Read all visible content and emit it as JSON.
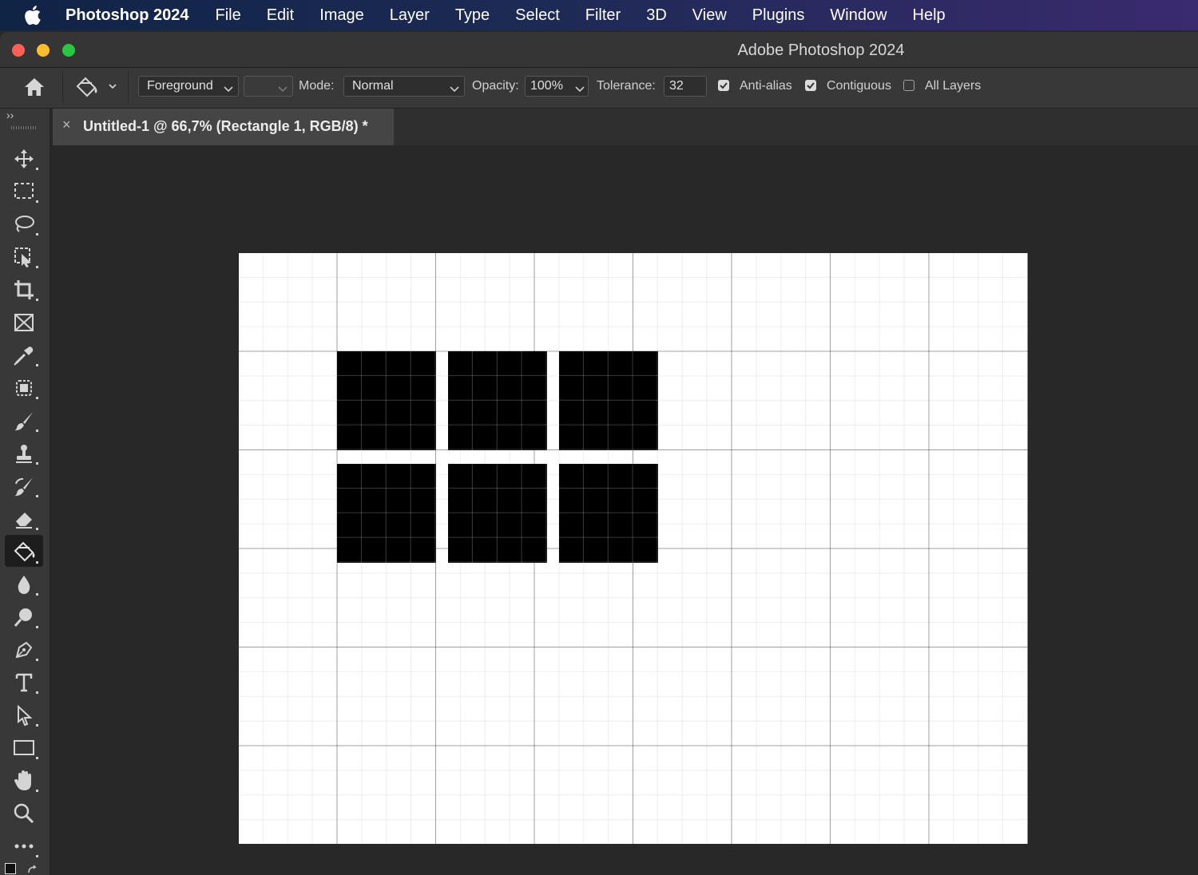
{
  "menubar": {
    "app_name": "Photoshop 2024",
    "items": [
      "File",
      "Edit",
      "Image",
      "Layer",
      "Type",
      "Select",
      "Filter",
      "3D",
      "View",
      "Plugins",
      "Window",
      "Help"
    ]
  },
  "window": {
    "title": "Adobe Photoshop 2024",
    "traffic_lights": {
      "close": "#ff5f57",
      "minimize": "#febc2e",
      "zoom": "#28c840"
    }
  },
  "options_bar": {
    "fill_source": "Foreground",
    "mode_label": "Mode:",
    "mode_value": "Normal",
    "opacity_label": "Opacity:",
    "opacity_value": "100%",
    "tolerance_label": "Tolerance:",
    "tolerance_value": "32",
    "anti_alias": {
      "label": "Anti-alias",
      "checked": true
    },
    "contiguous": {
      "label": "Contiguous",
      "checked": true
    },
    "all_layers": {
      "label": "All Layers",
      "checked": false
    }
  },
  "document_tab": {
    "title": "Untitled-1 @ 66,7% (Rectangle 1, RGB/8) *",
    "close_glyph": "×"
  },
  "toolbar": {
    "expand_glyph": "››",
    "tools": [
      "move-tool-icon",
      "marquee-tool-icon",
      "lasso-tool-icon",
      "object-selection-tool-icon",
      "crop-tool-icon",
      "frame-tool-icon",
      "eyedropper-tool-icon",
      "healing-brush-tool-icon",
      "brush-tool-icon",
      "clone-stamp-tool-icon",
      "history-brush-tool-icon",
      "eraser-tool-icon",
      "paint-bucket-tool-icon",
      "blur-tool-icon",
      "dodge-tool-icon",
      "pen-tool-icon",
      "type-tool-icon",
      "path-selection-tool-icon",
      "rectangle-tool-icon",
      "hand-tool-icon",
      "zoom-tool-icon",
      "more-tools-icon"
    ],
    "active_tool": "paint-bucket-tool-icon"
  },
  "canvas": {
    "background": "#ffffff",
    "shape_fill": "#000000",
    "shapes_count": 6
  }
}
